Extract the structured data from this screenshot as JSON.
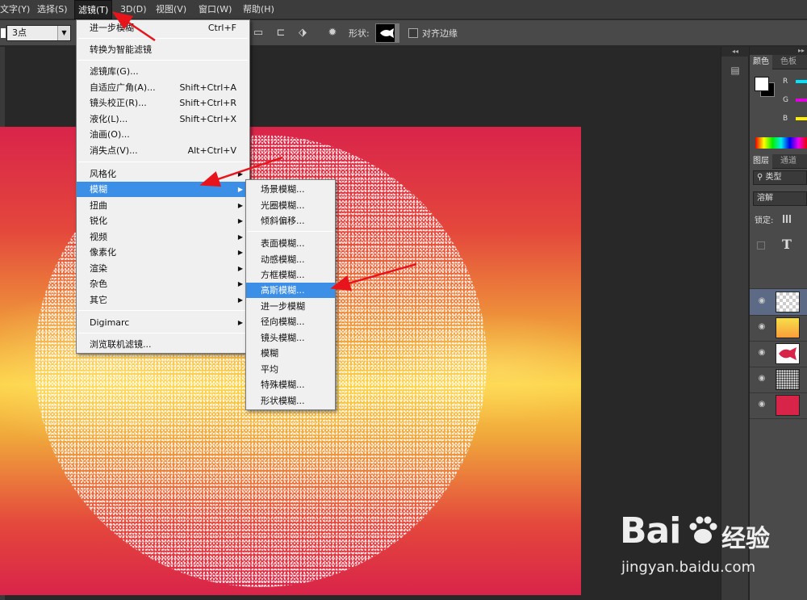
{
  "menubar": {
    "items": [
      "文字(Y)",
      "选择(S)",
      "滤镜(T)",
      "3D(D)",
      "视图(V)",
      "窗口(W)",
      "帮助(H)"
    ]
  },
  "options": {
    "size_value": "3点",
    "shape_label": "形状:",
    "align_edges_label": "对齐边缘"
  },
  "filter_menu": {
    "items": [
      {
        "label": "进一步模糊",
        "shortcut": "Ctrl+F"
      },
      {
        "label": "转换为智能滤镜",
        "shortcut": ""
      },
      {
        "label": "滤镜库(G)...",
        "shortcut": ""
      },
      {
        "label": "自适应广角(A)...",
        "shortcut": "Shift+Ctrl+A"
      },
      {
        "label": "镜头校正(R)...",
        "shortcut": "Shift+Ctrl+R"
      },
      {
        "label": "液化(L)...",
        "shortcut": "Shift+Ctrl+X"
      },
      {
        "label": "油画(O)...",
        "shortcut": ""
      },
      {
        "label": "消失点(V)...",
        "shortcut": "Alt+Ctrl+V"
      },
      {
        "label": "风格化",
        "shortcut": ""
      },
      {
        "label": "模糊",
        "shortcut": ""
      },
      {
        "label": "扭曲",
        "shortcut": ""
      },
      {
        "label": "锐化",
        "shortcut": ""
      },
      {
        "label": "视频",
        "shortcut": ""
      },
      {
        "label": "像素化",
        "shortcut": ""
      },
      {
        "label": "渲染",
        "shortcut": ""
      },
      {
        "label": "杂色",
        "shortcut": ""
      },
      {
        "label": "其它",
        "shortcut": ""
      },
      {
        "label": "Digimarc",
        "shortcut": ""
      },
      {
        "label": "浏览联机滤镜...",
        "shortcut": ""
      }
    ]
  },
  "blur_submenu": {
    "items": [
      "场景模糊...",
      "光圈模糊...",
      "倾斜偏移...",
      "表面模糊...",
      "动感模糊...",
      "方框模糊...",
      "高斯模糊...",
      "进一步模糊",
      "径向模糊...",
      "镜头模糊...",
      "模糊",
      "平均",
      "特殊模糊...",
      "形状模糊..."
    ]
  },
  "panels": {
    "color_tabs": [
      "颜色",
      "色板"
    ],
    "channels": [
      "R",
      "G",
      "B"
    ],
    "channel_colors": [
      "#00e5ff",
      "#e000e0",
      "#ffee00"
    ],
    "layer_tabs": [
      "图层",
      "通道"
    ],
    "kind_filter": "类型",
    "blend_mode": "溶解",
    "lock_label": "锁定:",
    "text_layer_glyph": "T"
  },
  "watermark": {
    "brand": "Bai",
    "cn": "经验",
    "url": "jingyan.baidu.com"
  }
}
